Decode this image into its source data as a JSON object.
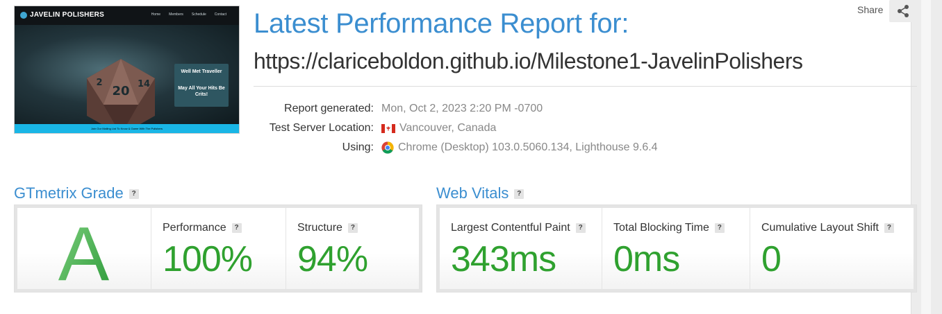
{
  "thumbnail": {
    "brand": "JAVELIN POLISHERS",
    "nav": [
      "Home",
      "Members",
      "Schedule",
      "Contact"
    ],
    "hero_line1": "Well Met Traveller",
    "hero_line2": "May All Your Hits Be Crits!",
    "footer": "Join Our Mailing List To Know & Game With The Polishers"
  },
  "header": {
    "title": "Latest Performance Report for:",
    "url": "https://clariceboldon.github.io/Milestone1-JavelinPolishers",
    "share_label": "Share"
  },
  "meta": {
    "generated_label": "Report generated:",
    "generated_value": "Mon, Oct 2, 2023 2:20 PM -0700",
    "location_label": "Test Server Location:",
    "location_value": "Vancouver, Canada",
    "using_label": "Using:",
    "using_value": "Chrome (Desktop) 103.0.5060.134, Lighthouse 9.6.4"
  },
  "grade_section": {
    "title": "GTmetrix Grade",
    "help": "?",
    "grade": "A",
    "metrics": [
      {
        "label": "Performance",
        "value": "100%"
      },
      {
        "label": "Structure",
        "value": "94%"
      }
    ]
  },
  "vitals_section": {
    "title": "Web Vitals",
    "help": "?",
    "metrics": [
      {
        "label": "Largest Contentful Paint",
        "value": "343ms"
      },
      {
        "label": "Total Blocking Time",
        "value": "0ms"
      },
      {
        "label": "Cumulative Layout Shift",
        "value": "0"
      }
    ]
  },
  "colors": {
    "accent_blue": "#3b8ed0",
    "good_green": "#2fa12f"
  },
  "icons": [
    "share-icon",
    "canada-flag-icon",
    "chrome-icon",
    "help-icon"
  ]
}
